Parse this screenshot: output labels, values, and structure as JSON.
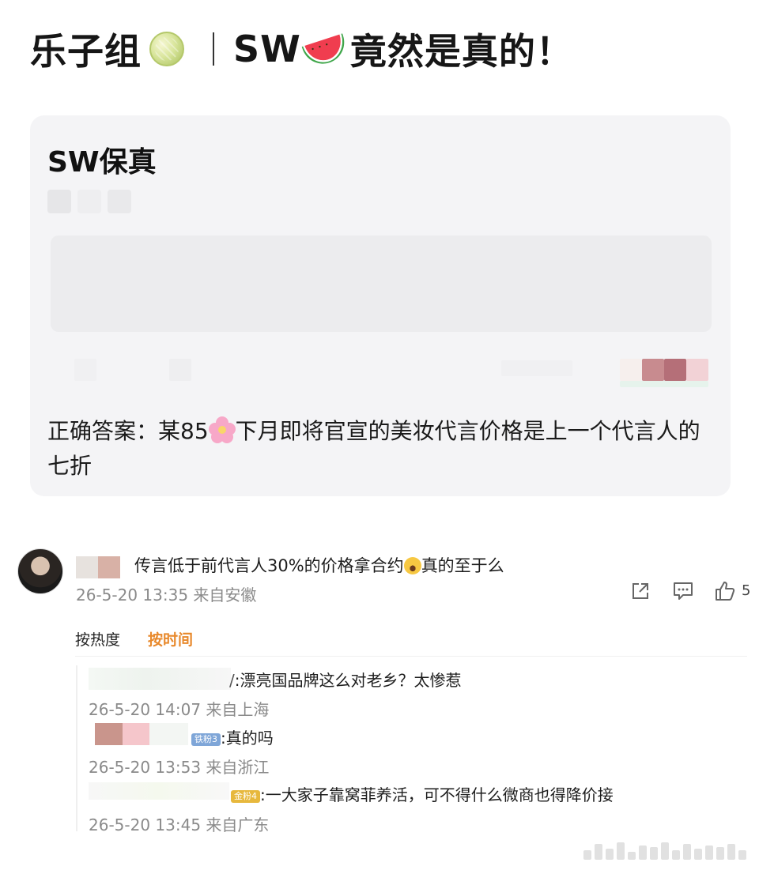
{
  "header": {
    "title_left": "乐子组",
    "title_left_emoji": "melon-emoji",
    "title_right_prefix": "SW",
    "title_right_emoji": "watermelon-emoji",
    "title_right_suffix": "竟然是真的！"
  },
  "card": {
    "heading": "SW保真",
    "answer_before": "正确答案：某85",
    "answer_emoji": "cherry-blossom-emoji",
    "answer_after": "下月即将官宣的美妆代言价格是上一个代言人的七折"
  },
  "comment": {
    "text_before": "传言低于前代言人30%的价格拿合约",
    "text_emoji": "laughing-emoji",
    "text_after": "真的至于么",
    "meta": "26-5-20 13:35 来自安徽",
    "like_count": "5"
  },
  "sort": {
    "hot": "按热度",
    "time": "按时间"
  },
  "replies": [
    {
      "prefix": "/",
      "text": ":漂亮国品牌这么对老乡？太惨惹",
      "meta": "26-5-20 14:07 来自上海"
    },
    {
      "badge": "铁粉3",
      "text": ":真的吗",
      "meta": "26-5-20 13:53 来自浙江"
    },
    {
      "badge": "金粉4",
      "text": ":一大家子靠窝菲养活，可不得什么微商也得降价接",
      "meta": "26-5-20 13:45 来自广东"
    }
  ],
  "colors": {
    "accent_orange": "#e8892c",
    "card_bg": "#f4f4f6",
    "meta_gray": "#8a8a8a"
  }
}
